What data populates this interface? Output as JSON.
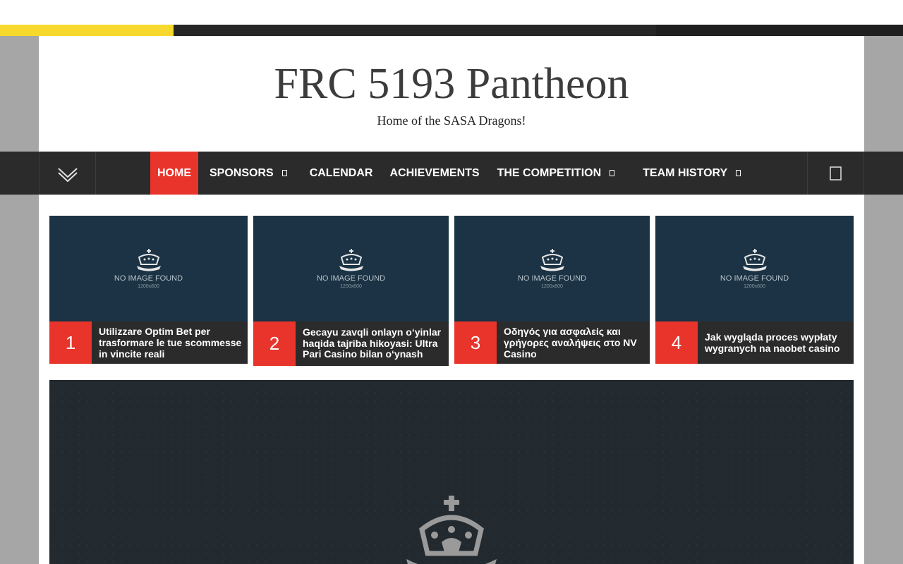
{
  "site": {
    "title": "FRC 5193 Pantheon",
    "tagline": "Home of the SASA Dragons!"
  },
  "colors": {
    "accent": "#e8342a",
    "nav_bg": "#2b2b2b",
    "top_yellow": "#f7d92d",
    "card_bg": "#1b3344",
    "side_bg": "#a6a6a6"
  },
  "nav": {
    "toggle_icon": "chevron-double-down-icon",
    "search_icon": "search-icon",
    "items": [
      {
        "label": "HOME",
        "active": true,
        "has_submenu": false
      },
      {
        "label": "SPONSORS",
        "active": false,
        "has_submenu": true
      },
      {
        "label": "CALENDAR",
        "active": false,
        "has_submenu": false
      },
      {
        "label": "ACHIEVEMENTS",
        "active": false,
        "has_submenu": false
      },
      {
        "label": "THE COMPETITION",
        "active": false,
        "has_submenu": true
      },
      {
        "label": "TEAM HISTORY",
        "active": false,
        "has_submenu": true
      }
    ]
  },
  "featured": [
    {
      "number": "1",
      "title": "Utilizzare Optim Bet per trasformare le tue scommesse in vincite reali",
      "image_text": "NO IMAGE FOUND",
      "image_size": "1200x800"
    },
    {
      "number": "2",
      "title": "Gecayu zavqli onlayn o‘yinlar haqida tajriba hikoyasi: Ultra Pari Casino bilan o‘ynash",
      "image_text": "NO IMAGE FOUND",
      "image_size": "1200x800"
    },
    {
      "number": "3",
      "title": "Οδηγός για ασφαλείς και γρήγορες αναλήψεις στο NV Casino",
      "image_text": "NO IMAGE FOUND",
      "image_size": "1200x800"
    },
    {
      "number": "4",
      "title": "Jak wygląda proces wypłaty wygranych na naobet casino",
      "image_text": "NO IMAGE FOUND",
      "image_size": "1200x800"
    }
  ]
}
